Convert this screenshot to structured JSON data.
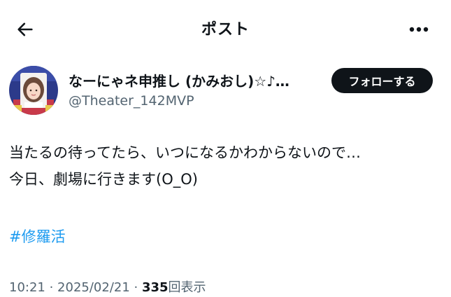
{
  "header": {
    "title": "ポスト",
    "back_icon": "arrow-left-icon",
    "more_icon": "more-horizontal-icon"
  },
  "author": {
    "display_name": "なーにゃネ申推し (かみおし)☆♪…",
    "handle": "@Theater_142MVP",
    "follow_label": "フォローする"
  },
  "tweet": {
    "lines": [
      "当たるの待ってたら、いつになるかわからないので…",
      "今日、劇場に行きます(O_O)"
    ],
    "hashtag": "#修羅活"
  },
  "meta": {
    "time": "10:21",
    "separator1": " · ",
    "date": "2025/02/21",
    "separator2": " · ",
    "views_count": "335",
    "views_label": "回表示"
  },
  "colors": {
    "text": "#0f1419",
    "secondary": "#536471",
    "link": "#1d9bf0",
    "button_bg": "#0f1419"
  }
}
